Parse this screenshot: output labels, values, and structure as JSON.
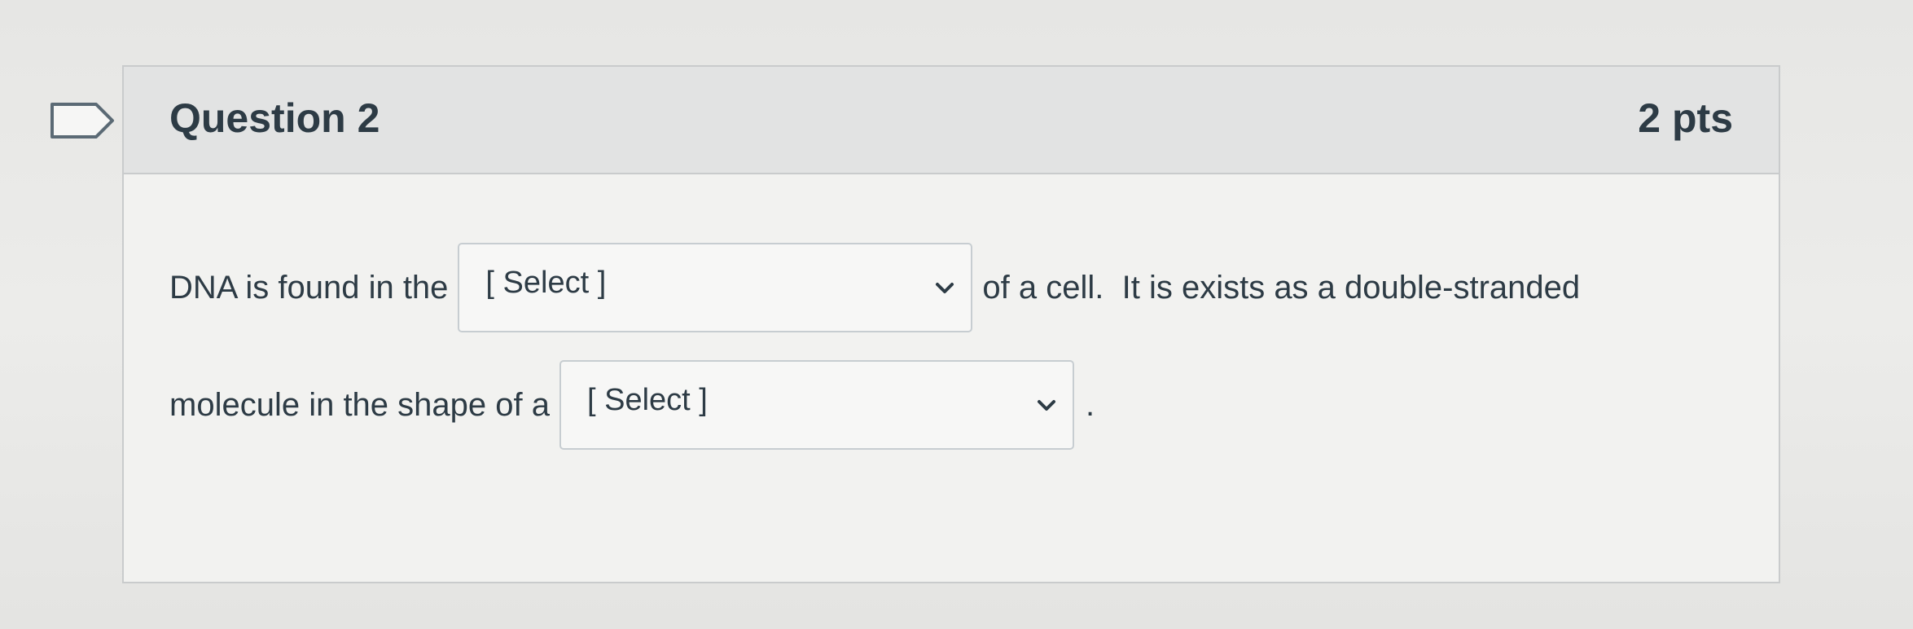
{
  "question": {
    "title": "Question 2",
    "points": "2 pts",
    "line1": {
      "before": "DNA is found in the",
      "after": "of a cell.  It is exists as a double-stranded"
    },
    "line2": {
      "before": "molecule in the shape of a",
      "after": "."
    },
    "select1": {
      "value": "[ Select ]"
    },
    "select2": {
      "value": "[ Select ]"
    }
  },
  "icons": {
    "flag": "flag-icon",
    "dropdown": "chevron-down-icon"
  },
  "colors": {
    "text": "#2d3b45",
    "header_bg": "#e2e3e3",
    "border": "#c9cbcc"
  }
}
